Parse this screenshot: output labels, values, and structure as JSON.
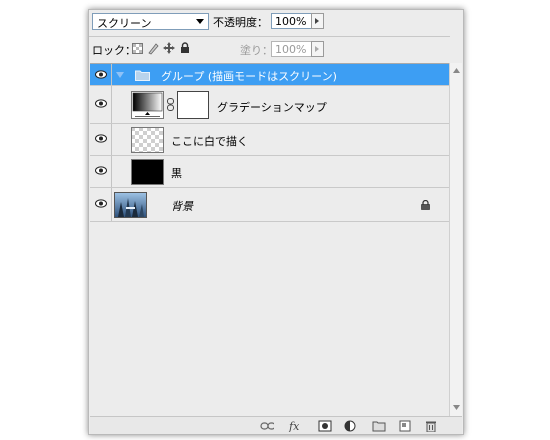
{
  "toolbar": {
    "blend_mode": "スクリーン",
    "opacity_label": "不透明度：",
    "opacity_value": "100%",
    "lock_label": "ロック：",
    "fill_label": "塗り：",
    "fill_value": "100%"
  },
  "layers": [
    {
      "name": "グループ (描画モードはスクリーン)",
      "type": "group",
      "selected": true,
      "visible": true
    },
    {
      "name": "グラデーションマップ",
      "type": "adjustment",
      "visible": true
    },
    {
      "name": "ここに白で描く",
      "type": "transparent",
      "visible": true
    },
    {
      "name": "黒",
      "type": "fill-black",
      "visible": true
    },
    {
      "name": "背景",
      "type": "background",
      "locked": true,
      "visible": true
    }
  ],
  "colors": {
    "selection": "#3d9ef3",
    "panel": "#ececec"
  },
  "footer_icons": [
    "link-layers-icon",
    "fx-icon",
    "add-mask-icon",
    "adjustment-layer-icon",
    "new-group-icon",
    "new-layer-icon",
    "trash-icon"
  ]
}
